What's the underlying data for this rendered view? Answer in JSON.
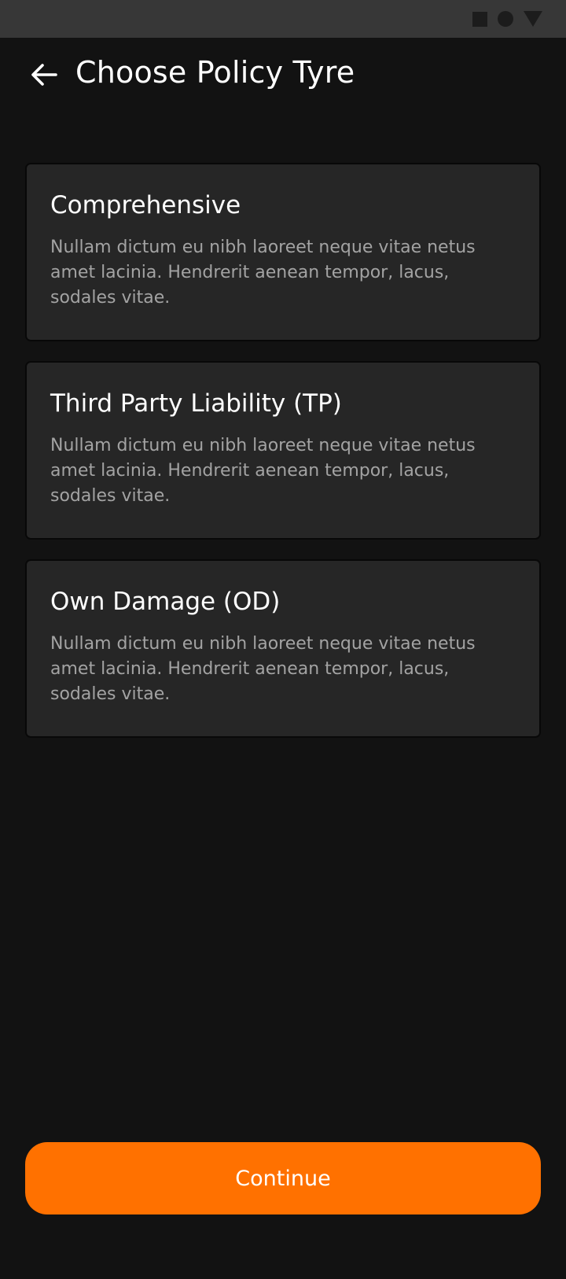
{
  "header": {
    "back_icon": "arrow-left-icon",
    "title": "Choose Policy Tyre"
  },
  "status_bar": {
    "icons": [
      "square-icon",
      "circle-icon",
      "triangle-icon"
    ]
  },
  "policies": [
    {
      "title": "Comprehensive",
      "description": "Nullam dictum eu nibh laoreet neque vitae netus amet lacinia. Hendrerit aenean tempor, lacus, sodales vitae."
    },
    {
      "title": "Third Party Liability (TP)",
      "description": "Nullam dictum eu nibh laoreet neque vitae netus amet lacinia. Hendrerit aenean tempor, lacus, sodales vitae."
    },
    {
      "title": "Own Damage (OD)",
      "description": "Nullam dictum eu nibh laoreet neque vitae netus amet lacinia. Hendrerit aenean tempor, lacus, sodales vitae."
    }
  ],
  "actions": {
    "continue_label": "Continue"
  },
  "colors": {
    "background": "#121212",
    "card": "#262626",
    "accent": "#ff7100",
    "description_text": "#a3a3a3"
  }
}
